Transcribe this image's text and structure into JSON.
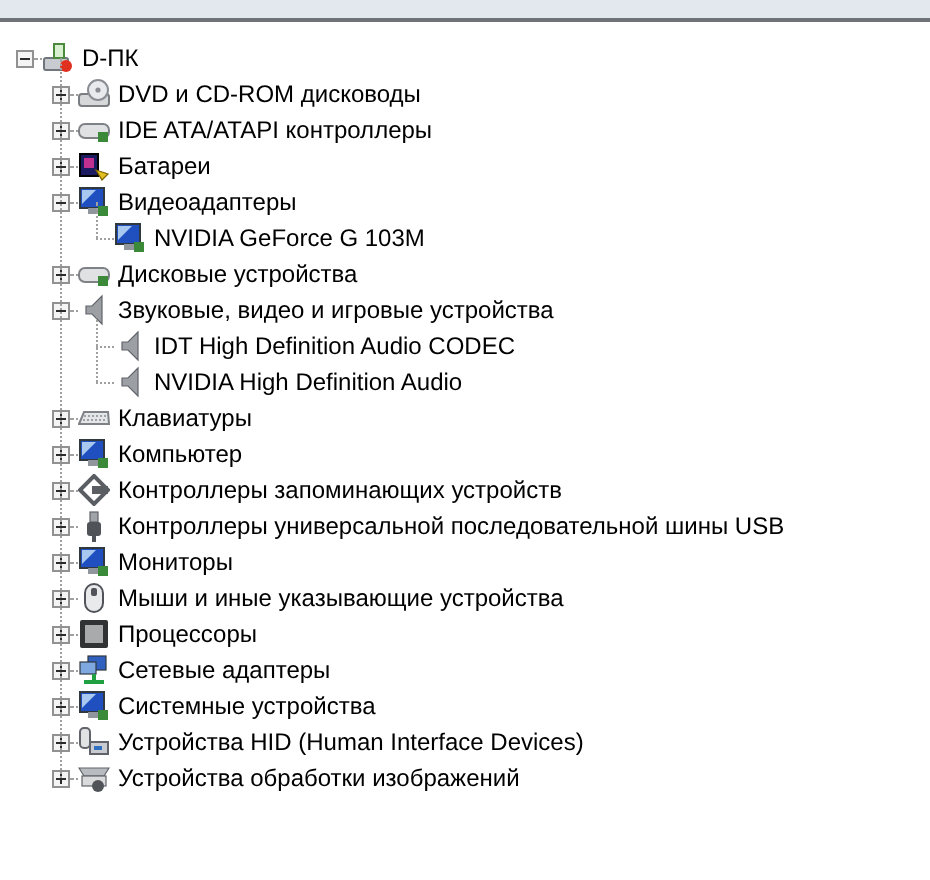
{
  "tree": {
    "label": "D-ПК",
    "expanded": true,
    "children": [
      {
        "label": "DVD и CD-ROM дисководы",
        "expanded": false
      },
      {
        "label": "IDE ATA/ATAPI контроллеры",
        "expanded": false
      },
      {
        "label": "Батареи",
        "expanded": false
      },
      {
        "label": "Видеоадаптеры",
        "expanded": true,
        "children": [
          {
            "label": "NVIDIA GeForce G 103M"
          }
        ]
      },
      {
        "label": "Дисковые устройства",
        "expanded": false
      },
      {
        "label": "Звуковые, видео и игровые устройства",
        "expanded": true,
        "children": [
          {
            "label": "IDT High Definition Audio CODEC"
          },
          {
            "label": "NVIDIA High Definition Audio"
          }
        ]
      },
      {
        "label": "Клавиатуры",
        "expanded": false
      },
      {
        "label": "Компьютер",
        "expanded": false
      },
      {
        "label": "Контроллеры запоминающих устройств",
        "expanded": false
      },
      {
        "label": "Контроллеры универсальной последовательной шины USB",
        "expanded": false
      },
      {
        "label": "Мониторы",
        "expanded": false
      },
      {
        "label": "Мыши и иные указывающие устройства",
        "expanded": false
      },
      {
        "label": "Процессоры",
        "expanded": false
      },
      {
        "label": "Сетевые адаптеры",
        "expanded": false
      },
      {
        "label": "Системные устройства",
        "expanded": false
      },
      {
        "label": "Устройства HID (Human Interface Devices)",
        "expanded": false
      },
      {
        "label": "Устройства обработки изображений",
        "expanded": false
      }
    ]
  }
}
